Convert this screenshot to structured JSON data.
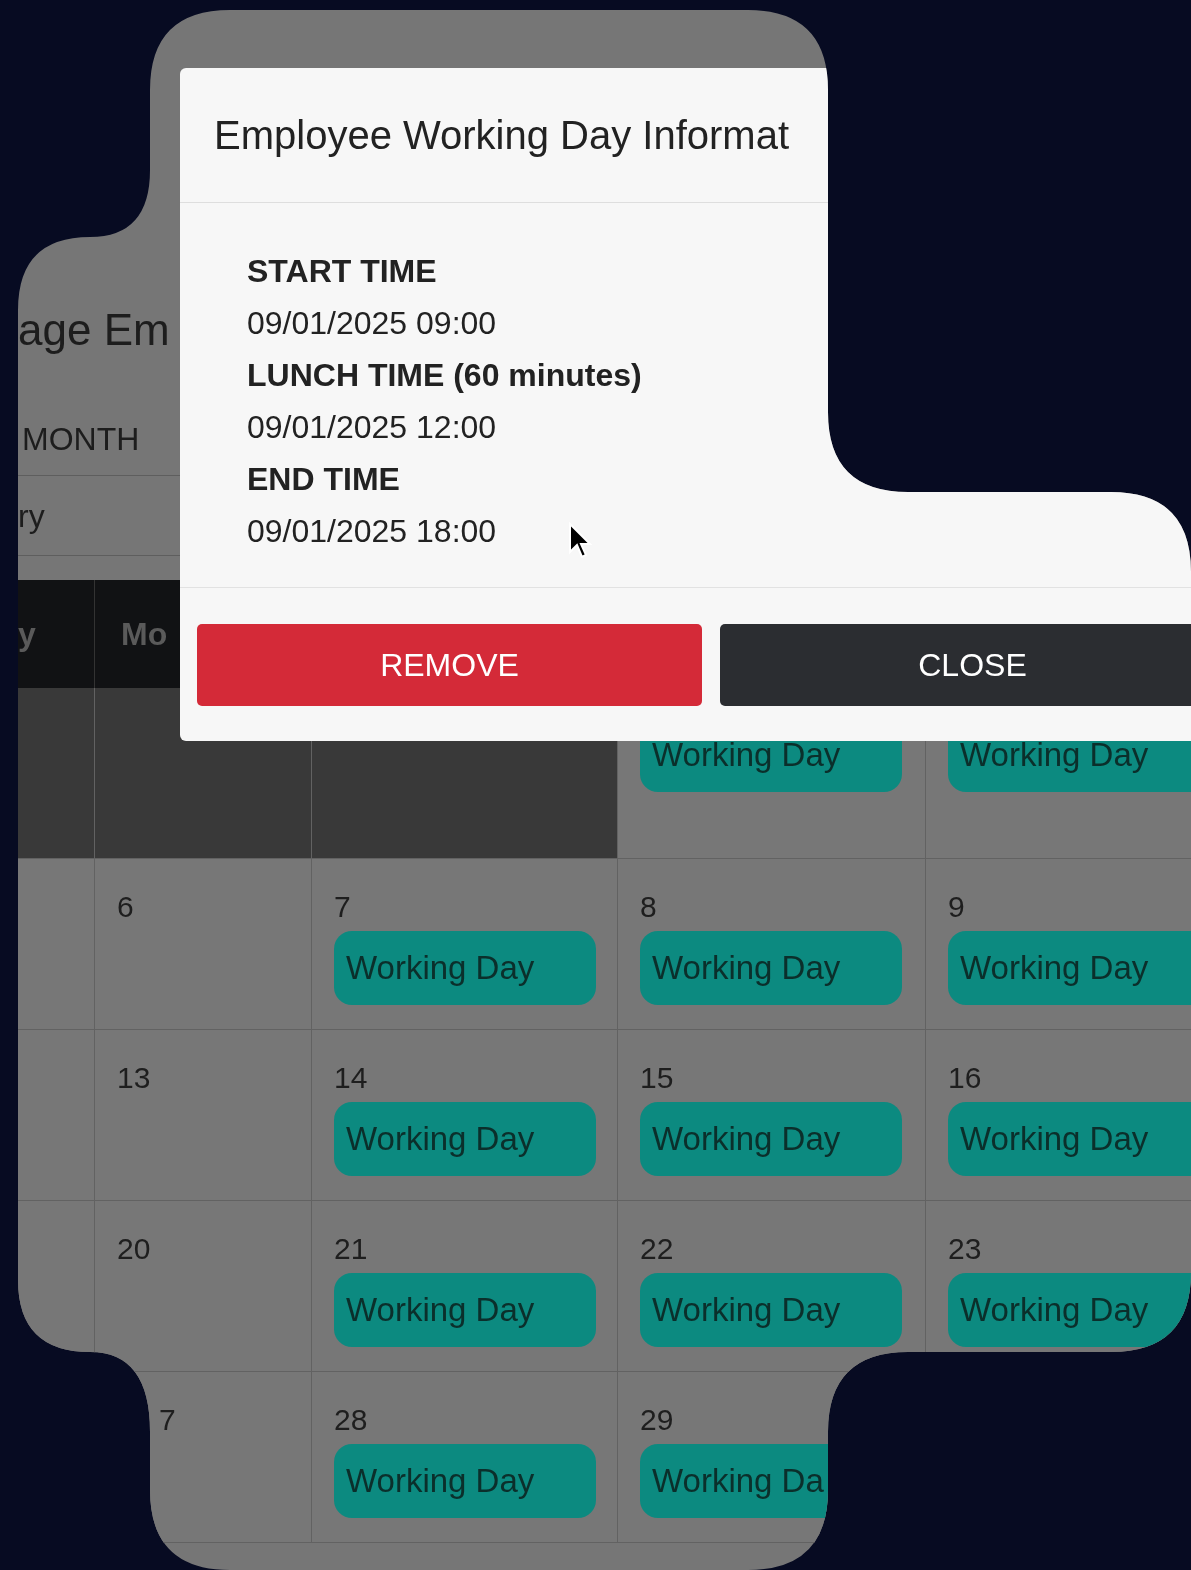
{
  "page": {
    "title": "age Em",
    "view_tab": "MONTH",
    "filter": "ry"
  },
  "calendar": {
    "headers": [
      "y",
      "Mo"
    ],
    "weeks": [
      {
        "cells": [
          {
            "outside": true
          },
          {
            "outside": true
          },
          {
            "outside": true
          },
          {
            "outside": false,
            "events": [
              "Working Day"
            ]
          },
          {
            "outside": false,
            "events": [
              "Working Day"
            ]
          }
        ]
      },
      {
        "cells": [
          {
            "outside": false
          },
          {
            "day": "6",
            "outside": false
          },
          {
            "day": "7",
            "outside": false,
            "events": [
              "Working Day"
            ]
          },
          {
            "day": "8",
            "outside": false,
            "events": [
              "Working Day"
            ]
          },
          {
            "day": "9",
            "outside": false,
            "events": [
              "Working Day"
            ]
          }
        ]
      },
      {
        "cells": [
          {
            "outside": false
          },
          {
            "day": "13",
            "outside": false
          },
          {
            "day": "14",
            "outside": false,
            "events": [
              "Working Day"
            ]
          },
          {
            "day": "15",
            "outside": false,
            "events": [
              "Working Day"
            ]
          },
          {
            "day": "16",
            "outside": false,
            "events": [
              "Working Day"
            ]
          }
        ]
      },
      {
        "cells": [
          {
            "outside": false
          },
          {
            "day": "20",
            "outside": false
          },
          {
            "day": "21",
            "outside": false,
            "events": [
              "Working Day"
            ]
          },
          {
            "day": "22",
            "outside": false,
            "events": [
              "Working Day"
            ]
          },
          {
            "day": "23",
            "outside": false,
            "events": [
              "Working Day"
            ]
          }
        ]
      },
      {
        "cells": [
          {},
          {
            "day": "7",
            "outside": false
          },
          {
            "day": "28",
            "outside": false,
            "events": [
              "Working Day"
            ]
          },
          {
            "day": "29",
            "outside": false,
            "events": [
              "Working Da"
            ]
          },
          {}
        ]
      }
    ]
  },
  "modal": {
    "title": "Employee Working Day Informat",
    "fields": [
      {
        "label": "START TIME",
        "value": "09/01/2025 09:00"
      },
      {
        "label": "LUNCH TIME (60 minutes)",
        "value": "09/01/2025 12:00"
      },
      {
        "label": "END TIME",
        "value": "09/01/2025 18:00"
      }
    ],
    "buttons": [
      {
        "label": "REMOVE",
        "kind": "danger"
      },
      {
        "label": "CLOSE",
        "kind": "dark"
      }
    ]
  }
}
